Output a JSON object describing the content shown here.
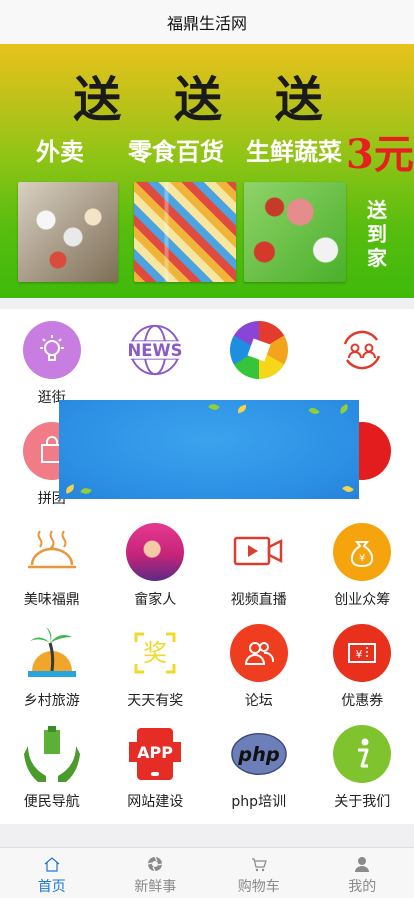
{
  "header": {
    "title": "福鼎生活网"
  },
  "banner": {
    "headline": "送 送 送",
    "items": [
      "外卖",
      "零食百货",
      "生鲜蔬菜"
    ],
    "price": "3元",
    "side_text": [
      "送",
      "到",
      "家"
    ]
  },
  "grid": {
    "rows": [
      [
        {
          "label": "逛街",
          "icon": "lightbulb-icon"
        },
        {
          "label": "",
          "icon": "news-icon"
        },
        {
          "label": "",
          "icon": "camera-shutter-icon"
        },
        {
          "label": "",
          "icon": "users-sync-icon"
        }
      ],
      [
        {
          "label": "拼团",
          "icon": "shopping-bag-icon"
        },
        {
          "label": "",
          "icon": "hidden-icon"
        },
        {
          "label": "",
          "icon": "hidden-icon"
        },
        {
          "label": "",
          "icon": "red-circle-icon"
        }
      ],
      [
        {
          "label": "美味福鼎",
          "icon": "food-dish-icon"
        },
        {
          "label": "畲家人",
          "icon": "person-avatar-icon"
        },
        {
          "label": "视频直播",
          "icon": "video-camera-icon"
        },
        {
          "label": "创业众筹",
          "icon": "money-bag-icon"
        }
      ],
      [
        {
          "label": "乡村旅游",
          "icon": "palm-tree-icon"
        },
        {
          "label": "天天有奖",
          "icon": "prize-icon"
        },
        {
          "label": "论坛",
          "icon": "forum-icon"
        },
        {
          "label": "优惠券",
          "icon": "coupon-icon"
        }
      ],
      [
        {
          "label": "便民导航",
          "icon": "gift-hands-icon"
        },
        {
          "label": "网站建设",
          "icon": "app-icon"
        },
        {
          "label": "php培训",
          "icon": "php-icon"
        },
        {
          "label": "关于我们",
          "icon": "info-icon"
        }
      ]
    ]
  },
  "tabbar": {
    "items": [
      {
        "label": "首页",
        "icon": "home-icon",
        "active": true
      },
      {
        "label": "新鲜事",
        "icon": "aperture-icon",
        "active": false
      },
      {
        "label": "购物车",
        "icon": "cart-icon",
        "active": false
      },
      {
        "label": "我的",
        "icon": "user-icon",
        "active": false
      }
    ]
  },
  "colors": {
    "accent": "#1c78d6",
    "banner_green": "#3fb90b",
    "banner_yellow": "#e7c21c"
  }
}
